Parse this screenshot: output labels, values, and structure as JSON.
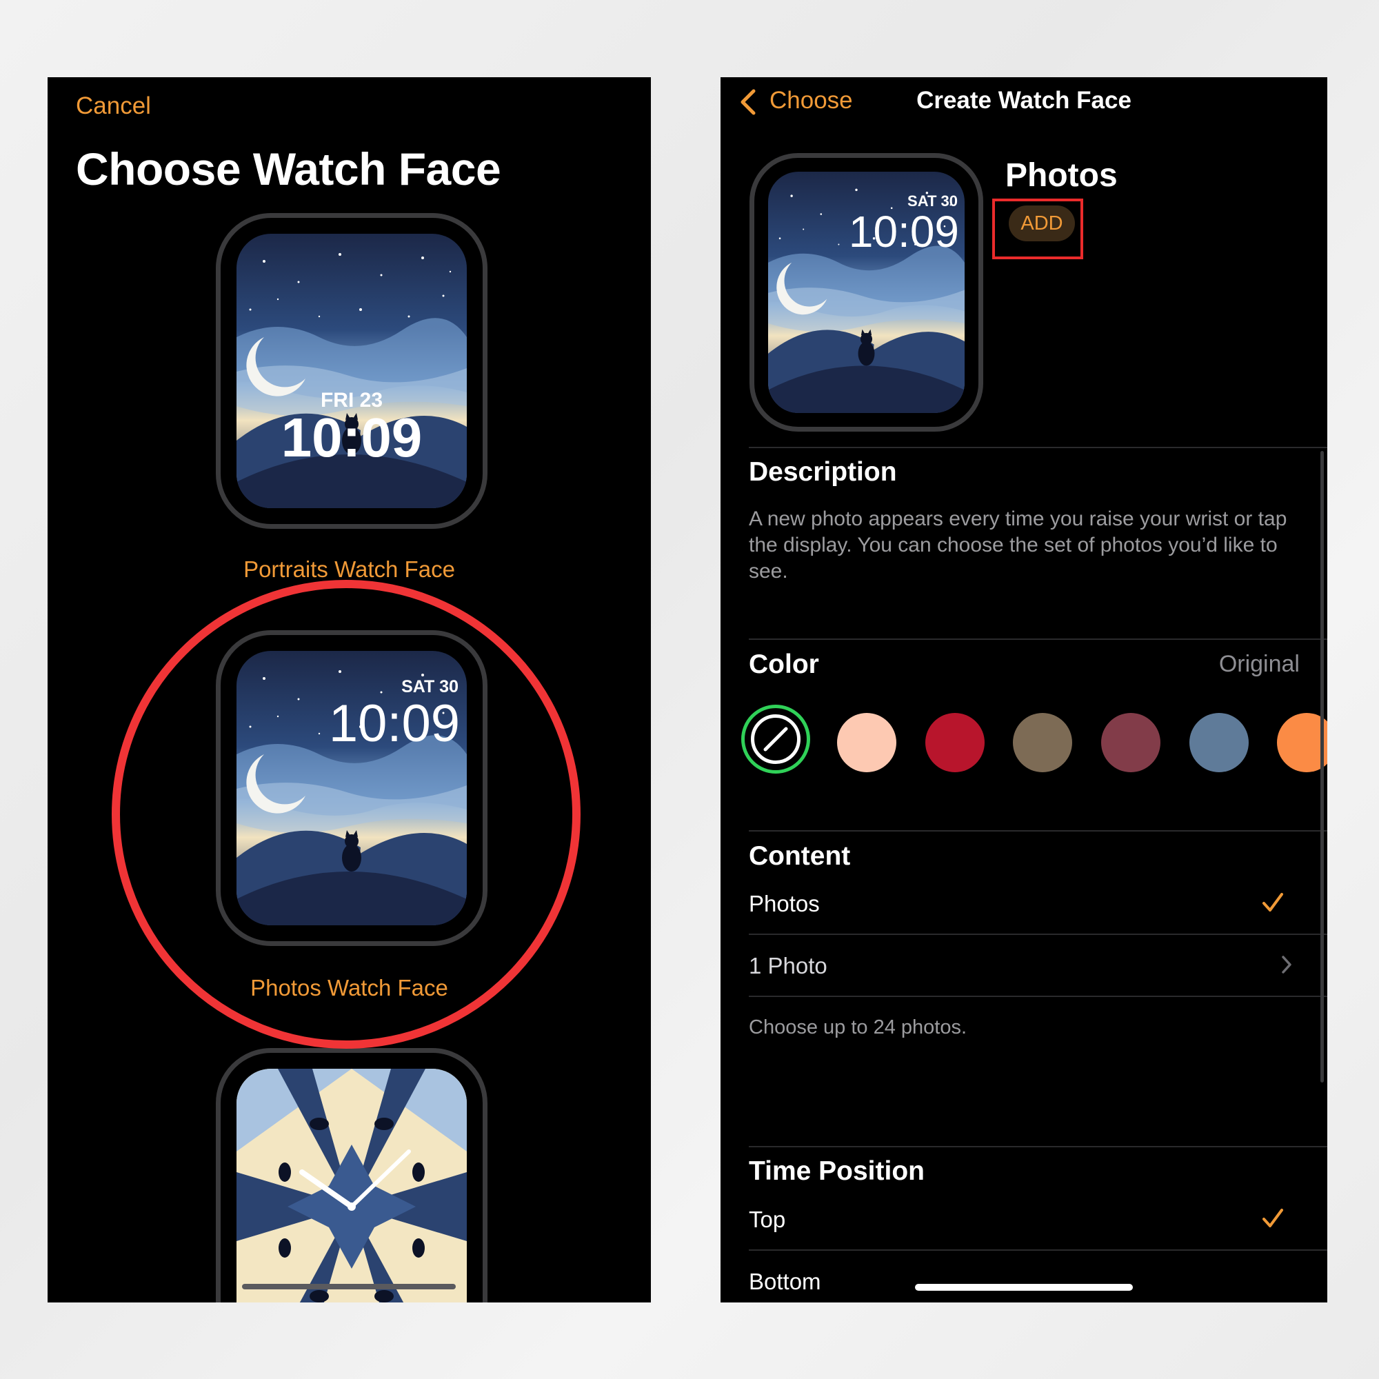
{
  "left": {
    "cancel_label": "Cancel",
    "title": "Choose Watch Face",
    "faces": [
      {
        "label": "Portraits Watch Face",
        "date": "FRI 23",
        "time": "10:09"
      },
      {
        "label": "Photos Watch Face",
        "date": "SAT 30",
        "time": "10:09"
      },
      {
        "label": "",
        "date": "",
        "time": ""
      }
    ]
  },
  "right": {
    "back_label": "Choose",
    "nav_title": "Create Watch Face",
    "preview": {
      "date": "SAT 30",
      "time": "10:09"
    },
    "face_name": "Photos",
    "add_label": "ADD",
    "description": {
      "header": "Description",
      "text": "A new photo appears every time you raise your wrist or tap the display. You can choose the set of photos you’d like to see."
    },
    "color": {
      "header": "Color",
      "value": "Original",
      "swatches": [
        "none",
        "#fdc9b2",
        "#b8152c",
        "#7d6b55",
        "#823c49",
        "#5f7b99",
        "#fb8b45"
      ]
    },
    "content": {
      "header": "Content",
      "option_photos": "Photos",
      "photo_count": "1 Photo",
      "hint": "Choose up to 24 photos."
    },
    "time_position": {
      "header": "Time Position",
      "option_top": "Top",
      "option_bottom": "Bottom"
    }
  },
  "colors": {
    "accent": "#f19a37",
    "highlight_red": "#f03436",
    "selected_green": "#30d158"
  }
}
